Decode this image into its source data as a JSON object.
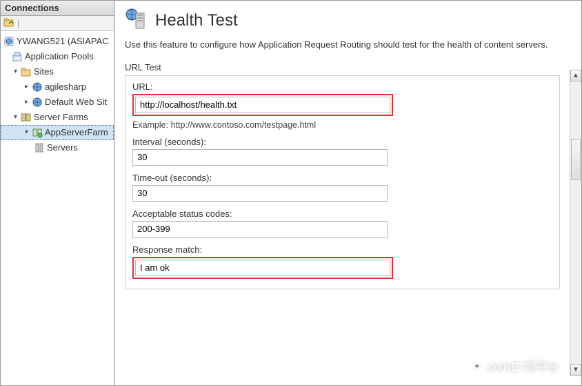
{
  "panel": {
    "title": "Connections"
  },
  "tree": {
    "root": "YWANG521 (ASIAPAC",
    "app_pools": "Application Pools",
    "sites": "Sites",
    "site1": "agilesharp",
    "site2": "Default Web Sit",
    "server_farms": "Server Farms",
    "farm1": "AppServerFarm",
    "servers": "Servers"
  },
  "page": {
    "title": "Health Test",
    "description": "Use this feature to configure how Application Request Routing should test for the health of content servers.",
    "group_label": "URL Test",
    "url_label": "URL:",
    "url_value": "http://localhost/health.txt",
    "url_example": "Example: http://www.contoso.com/testpage.html",
    "interval_label": "Interval (seconds):",
    "interval_value": "30",
    "timeout_label": "Time-out (seconds):",
    "timeout_value": "30",
    "status_label": "Acceptable status codes:",
    "status_value": "200-399",
    "response_label": "Response match:",
    "response_value": "I am ok"
  },
  "watermark": "dotNET跨平台"
}
